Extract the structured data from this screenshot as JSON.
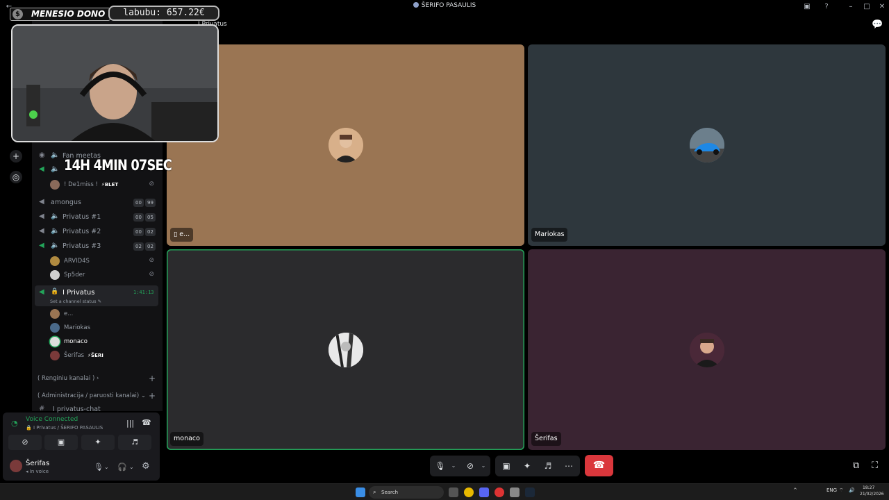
{
  "window": {
    "title": "ŠERIFO PASAULIS"
  },
  "overlay": {
    "donate_label": "MENESIO DONO",
    "balance_text": "labubu: 657.22€",
    "timer_text": "14H 4MIN 07SEC"
  },
  "sidebar": {
    "header_server": "ŠERIFO PASAULIS",
    "obscured_channels": [
      "Fan meetas",
      "Privatus"
    ],
    "channels": [
      {
        "name": "! De1miss !",
        "type": "user",
        "tag": "BLET"
      },
      {
        "name": "amongus",
        "type": "voice",
        "count_a": "00",
        "count_b": "99"
      },
      {
        "name": "Privatus #1",
        "type": "voice",
        "count_a": "00",
        "count_b": "05"
      },
      {
        "name": "Privatus #2",
        "type": "voice",
        "count_a": "00",
        "count_b": "02"
      },
      {
        "name": "Privatus #3",
        "type": "voice",
        "count_a": "02",
        "count_b": "02"
      }
    ],
    "privatus3_users": [
      "ARVID4S",
      "Sp5der"
    ],
    "active_channel": {
      "name": "Privatus",
      "duration": "1:41:13",
      "status_placeholder": "Set a channel status"
    },
    "active_users": [
      {
        "name": "e..."
      },
      {
        "name": "Mariokas"
      },
      {
        "name": "monaco"
      },
      {
        "name": "Šerifas",
        "tag": "ŠERI"
      }
    ],
    "categories": [
      {
        "label": "( Renginiu kanalai )"
      },
      {
        "label": "( Administracija / paruosti kanalai)"
      }
    ],
    "text_channel": "privatus-chat"
  },
  "voice_panel": {
    "status": "Voice Connected",
    "location": "Privatus / ŠERIFO PASAULIS",
    "user_name": "Šerifas",
    "user_status": "In voice"
  },
  "stage": {
    "tiles": [
      {
        "label": "e...",
        "bg": "#9a7553",
        "speaking": false
      },
      {
        "label": "Mariokas",
        "bg": "#2e373d",
        "speaking": false
      },
      {
        "label": "monaco",
        "bg": "#2b2b2d",
        "speaking": true
      },
      {
        "label": "Šerifas",
        "bg": "#3a2432",
        "speaking": false
      }
    ]
  },
  "taskbar": {
    "search_label": "Search",
    "language": "ENG",
    "time": "18:27",
    "date": "21/02/2026"
  },
  "colors": {
    "accent_green": "#23a55a",
    "hangup_red": "#da373c",
    "sidebar_bg": "#121214"
  }
}
